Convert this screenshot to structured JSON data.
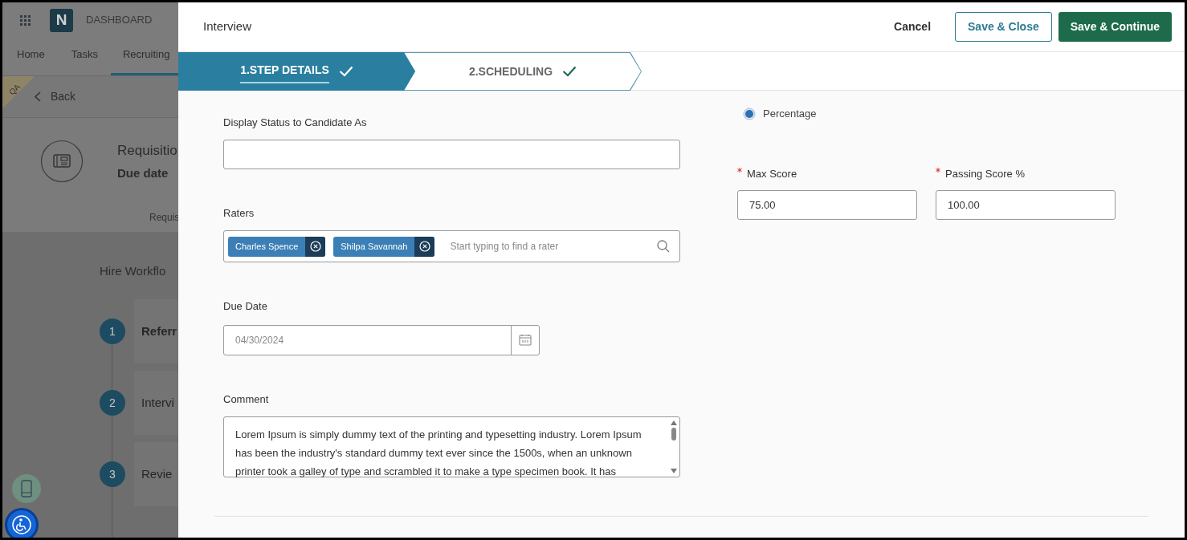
{
  "background_page": {
    "logo": "N",
    "app_title": "DASHBOARD",
    "env_badge": "QA",
    "nav_tabs": [
      {
        "label": "Home",
        "selected": false
      },
      {
        "label": "Tasks",
        "selected": false
      },
      {
        "label": "Recruiting",
        "selected": true
      }
    ],
    "back": "Back",
    "requisition_title": "Requisitio",
    "due_date": "Due date",
    "tab_label": "Requis",
    "workflow_title": "Hire Workflo",
    "workflow_steps": [
      {
        "number": "1",
        "label": "Referr",
        "bold": true
      },
      {
        "number": "2",
        "label": "Intervi",
        "bold": false
      },
      {
        "number": "3",
        "label": "Revie",
        "bold": false
      }
    ]
  },
  "dialog": {
    "title": "Interview",
    "buttons": [
      {
        "label": "Cancel",
        "kind": "text"
      },
      {
        "label": "Save & Close",
        "kind": "outline"
      },
      {
        "label": "Save & Continue",
        "kind": "primary"
      }
    ],
    "steps": [
      {
        "label": "1.STEP DETAILS",
        "selected": true,
        "completed": true
      },
      {
        "label": "2.SCHEDULING",
        "selected": false,
        "completed": true
      }
    ],
    "form": {
      "display_status": {
        "label": "Display Status to Candidate As"
      },
      "raters": {
        "label": "Raters",
        "chips": [
          "Charles Spence",
          "Shilpa Savannah"
        ],
        "placeholder": "Start typing to find a rater"
      },
      "due_date": {
        "label": "Due Date",
        "placeholder": "04/30/2024"
      },
      "comment": {
        "label": "Comment",
        "value": "Lorem Ipsum is simply dummy text of the printing and typesetting industry. Lorem Ipsum has been the industry's standard dummy text ever since the 1500s, when an unknown printer took a galley of type and scrambled it to make a type specimen book. It has"
      },
      "score_type": [
        {
          "label": "Percentage",
          "selected": true
        }
      ],
      "scores": [
        {
          "label": "Max Score",
          "required": true,
          "value": "75.00"
        },
        {
          "label": "Passing Score %",
          "required": true,
          "value": "100.00"
        }
      ]
    }
  }
}
